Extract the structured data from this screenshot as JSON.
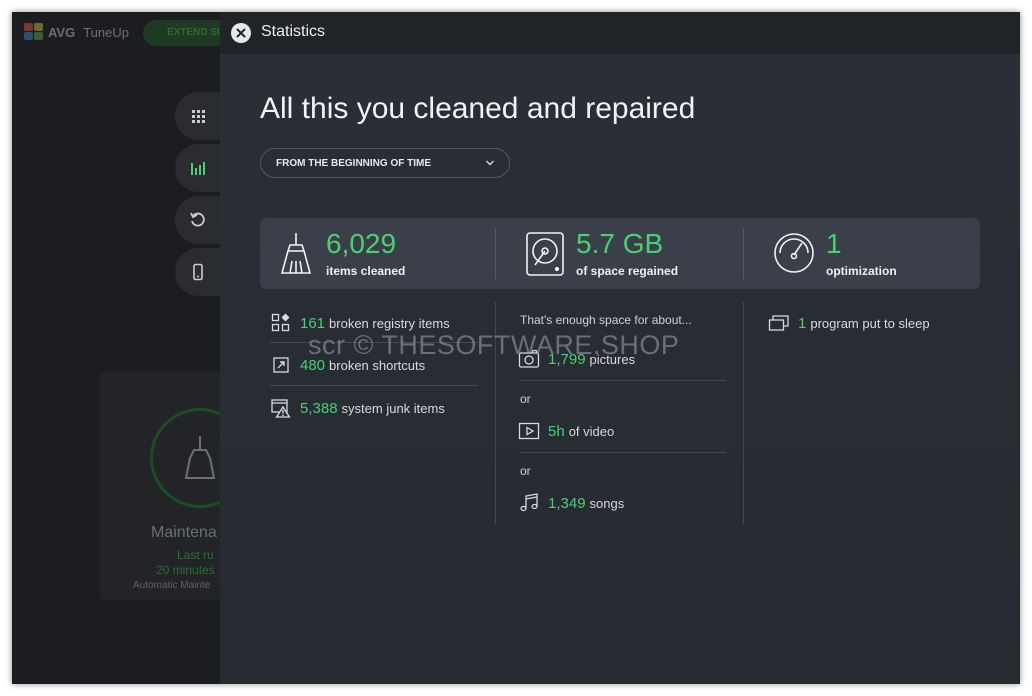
{
  "app": {
    "brand": "AVG",
    "product": "TuneUp",
    "extend_button": "EXTEND SU"
  },
  "background_card": {
    "title": "Maintena",
    "line1": "Last ru",
    "line2": "20 minutes",
    "line3": "Automatic Mainte"
  },
  "panel": {
    "title": "Statistics",
    "headline": "All this you cleaned and repaired",
    "period_select": "FROM THE BEGINNING OF TIME"
  },
  "summary": [
    {
      "value": "6,029",
      "label": "items cleaned",
      "icon": "broom-icon"
    },
    {
      "value": "5.7 GB",
      "label": "of space regained",
      "icon": "hard-drive-icon"
    },
    {
      "value": "1",
      "label": "optimization",
      "icon": "speedometer-icon"
    }
  ],
  "cleaned": [
    {
      "value": "161",
      "label": "broken registry items",
      "icon": "registry-icon"
    },
    {
      "value": "480",
      "label": "broken shortcuts",
      "icon": "shortcut-icon"
    },
    {
      "value": "5,388",
      "label": "system junk items",
      "icon": "junk-warning-icon"
    }
  ],
  "space": {
    "intro": "That's enough space for about...",
    "or": "or",
    "items": [
      {
        "value": "1,799",
        "label": "pictures",
        "icon": "camera-icon"
      },
      {
        "value": "5h",
        "label": "of video",
        "icon": "video-icon"
      },
      {
        "value": "1,349",
        "label": "songs",
        "icon": "music-note-icon"
      }
    ]
  },
  "optimization": [
    {
      "value": "1",
      "label": "program put to sleep",
      "icon": "sleep-windows-icon"
    }
  ],
  "watermark": "scr © THESOFTWARE.SHOP",
  "colors": {
    "accent_green": "#4ccf72",
    "panel_bg": "#2a2e36",
    "card_bg": "#3a3f4a"
  }
}
